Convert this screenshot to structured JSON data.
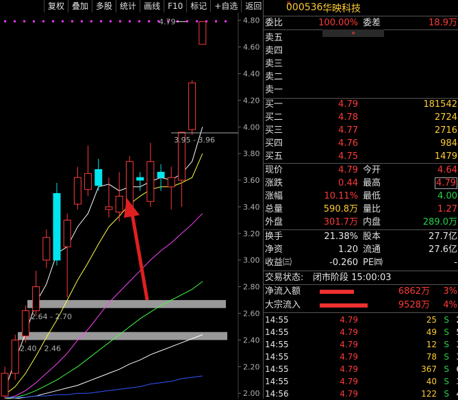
{
  "toolbar": {
    "buttons": [
      "复权",
      "叠加",
      "多股",
      "统计",
      "画线",
      "F10",
      "标记",
      "+自选",
      "返回"
    ]
  },
  "colors": {
    "up": "#ff3b3b",
    "down": "#00e5ee",
    "ma5": "#ffffff",
    "ma10": "#ffff44",
    "ma20": "#ff44ff",
    "ma30": "#44ff44",
    "ma60": "#ffffff",
    "ma120": "#3355ff"
  },
  "chart_data": {
    "type": "candlestick",
    "y_ticks": [
      "4.80",
      "4.60",
      "4.40",
      "4.20",
      "4.00",
      "3.80",
      "3.60",
      "3.40",
      "3.20",
      "3.00",
      "2.80",
      "2.60",
      "2.40",
      "2.20",
      "2.00"
    ],
    "ylim": [
      1.96,
      4.86
    ],
    "annotations": {
      "high_label": "4.79",
      "box_label": "3.95 - 3.96",
      "gap_upper_label": "2.64 - 2.70",
      "gap_lower_label": "2.40 - 2.46"
    },
    "candles": [
      {
        "o": 1.98,
        "c": 2.15,
        "h": 2.2,
        "l": 1.96
      },
      {
        "o": 2.15,
        "c": 2.4,
        "h": 2.44,
        "l": 2.1
      },
      {
        "o": 2.43,
        "c": 2.62,
        "h": 2.66,
        "l": 2.38
      },
      {
        "o": 2.62,
        "c": 2.8,
        "h": 2.92,
        "l": 2.58
      },
      {
        "o": 3.0,
        "c": 3.17,
        "h": 3.23,
        "l": 2.94
      },
      {
        "o": 3.5,
        "c": 3.0,
        "h": 3.58,
        "l": 2.96
      },
      {
        "o": 3.1,
        "c": 3.3,
        "h": 3.35,
        "l": 2.72
      },
      {
        "o": 3.42,
        "c": 3.62,
        "h": 3.7,
        "l": 3.38
      },
      {
        "o": 3.53,
        "c": 3.65,
        "h": 3.86,
        "l": 3.48
      },
      {
        "o": 3.68,
        "c": 3.56,
        "h": 3.76,
        "l": 3.52
      },
      {
        "o": 3.38,
        "c": 3.4,
        "h": 3.62,
        "l": 3.32
      },
      {
        "o": 3.36,
        "c": 3.48,
        "h": 3.66,
        "l": 3.29
      },
      {
        "o": 3.4,
        "c": 3.74,
        "h": 3.78,
        "l": 3.33
      },
      {
        "o": 3.62,
        "c": 3.6,
        "h": 3.66,
        "l": 3.52
      },
      {
        "o": 3.44,
        "c": 3.74,
        "h": 3.88,
        "l": 3.4
      },
      {
        "o": 3.66,
        "c": 3.62,
        "h": 3.72,
        "l": 3.52
      },
      {
        "o": 3.55,
        "c": 3.62,
        "h": 3.7,
        "l": 3.38
      },
      {
        "o": 3.6,
        "c": 3.96,
        "h": 3.96,
        "l": 3.4
      },
      {
        "o": 3.98,
        "c": 4.33,
        "h": 4.35,
        "l": 3.94
      },
      {
        "o": 4.62,
        "c": 4.79,
        "h": 4.79,
        "l": 4.62
      }
    ],
    "series": [
      {
        "values": [
          2.02,
          2.25,
          2.45,
          2.68,
          2.82,
          3.05,
          3.1,
          3.25,
          3.35,
          3.55,
          3.57,
          3.52,
          3.55,
          3.55,
          3.59,
          3.62,
          3.6,
          3.65,
          3.74,
          4.0
        ]
      },
      {
        "values": [
          1.99,
          2.05,
          2.15,
          2.28,
          2.42,
          2.55,
          2.7,
          2.85,
          2.98,
          3.12,
          3.25,
          3.33,
          3.42,
          3.48,
          3.53,
          3.55,
          3.55,
          3.58,
          3.62,
          3.8
        ]
      },
      {
        "values": [
          1.96,
          1.98,
          2.02,
          2.08,
          2.15,
          2.22,
          2.3,
          2.4,
          2.48,
          2.58,
          2.68,
          2.76,
          2.84,
          2.92,
          3.0,
          3.07,
          3.13,
          3.2,
          3.27,
          3.35
        ]
      },
      {
        "values": [
          1.96,
          1.97,
          1.99,
          2.02,
          2.06,
          2.1,
          2.15,
          2.2,
          2.26,
          2.32,
          2.38,
          2.44,
          2.5,
          2.56,
          2.61,
          2.66,
          2.7,
          2.74,
          2.78,
          2.84
        ]
      },
      {
        "values": [
          1.96,
          1.96,
          1.97,
          1.98,
          2.0,
          2.02,
          2.04,
          2.06,
          2.09,
          2.12,
          2.15,
          2.18,
          2.22,
          2.25,
          2.29,
          2.32,
          2.35,
          2.38,
          2.41,
          2.44
        ]
      },
      {
        "values": [
          1.97,
          1.97,
          1.97,
          1.98,
          1.98,
          1.99,
          1.99,
          2.0,
          2.0,
          2.01,
          2.02,
          2.03,
          2.04,
          2.05,
          2.07,
          2.08,
          2.09,
          2.11,
          2.12,
          2.13
        ]
      }
    ]
  },
  "header": {
    "r_badge": "R",
    "code": "000536",
    "name": "华映科技"
  },
  "quote": {
    "weibi_label": "委比",
    "weibi_value": "100.00%",
    "weicha_label": "委差",
    "weicha_value": "18.9万",
    "chevron": "»",
    "sells": [
      {
        "label": "卖五"
      },
      {
        "label": "卖四"
      },
      {
        "label": "卖三"
      },
      {
        "label": "卖二"
      },
      {
        "label": "卖一"
      }
    ],
    "buys": [
      {
        "label": "买一",
        "price": "4.79",
        "vol": "181542"
      },
      {
        "label": "买二",
        "price": "4.78",
        "vol": "2724"
      },
      {
        "label": "买三",
        "price": "4.77",
        "vol": "2716"
      },
      {
        "label": "买四",
        "price": "4.76",
        "vol": "984"
      },
      {
        "label": "买五",
        "price": "4.75",
        "vol": "1479"
      }
    ],
    "stats": [
      {
        "l1": "现价",
        "v1": "4.79",
        "c1": "red",
        "l2": "今开",
        "v2": "4.64",
        "c2": "red"
      },
      {
        "l1": "涨跌",
        "v1": "0.44",
        "c1": "red",
        "l2": "最高",
        "v2": "4.79",
        "c2": "red",
        "boxed": true
      },
      {
        "l1": "涨幅",
        "v1": "10.11%",
        "c1": "red",
        "l2": "最低",
        "v2": "4.00",
        "c2": "green"
      },
      {
        "l1": "总量",
        "v1": "590.8万",
        "c1": "yellow",
        "l2": "量比",
        "v2": "1.27",
        "c2": "red"
      },
      {
        "l1": "外盘",
        "v1": "301.7万",
        "c1": "red",
        "l2": "内盘",
        "v2": "289.0万",
        "c2": "green"
      }
    ],
    "stats2": [
      {
        "l1": "换手",
        "v1": "21.38%",
        "l2": "股本",
        "v2": "27.7亿"
      },
      {
        "l1": "净资",
        "v1": "1.20",
        "l2": "流通",
        "v2": "27.6亿"
      },
      {
        "l1": "收益㈢",
        "v1": "-0.260",
        "l2": "PE㈣",
        "v2": "-"
      }
    ],
    "status_label": "交易状态:",
    "status_value": "闭市阶段 15:00:03",
    "flows": [
      {
        "label": "净流入额",
        "value": "6862万",
        "pct": "3%"
      },
      {
        "label": "大宗流入",
        "value": "9528万",
        "pct": "4%"
      }
    ],
    "ticks": [
      {
        "time": "14:55",
        "price": "4.79",
        "vol": "25",
        "side": "S",
        "n": "2"
      },
      {
        "time": "14:55",
        "price": "4.79",
        "vol": "49",
        "side": "S",
        "n": "5"
      },
      {
        "time": "14:55",
        "price": "4.79",
        "vol": "12",
        "side": "S",
        "n": "3"
      },
      {
        "time": "14:55",
        "price": "4.79",
        "vol": "78",
        "side": "S",
        "n": "3"
      },
      {
        "time": "14:55",
        "price": "4.79",
        "vol": "367",
        "side": "S",
        "n": "6"
      },
      {
        "time": "14:55",
        "price": "4.79",
        "vol": "40",
        "side": "S",
        "n": "3"
      },
      {
        "time": "14:56",
        "price": "4.79",
        "vol": "122",
        "side": "S",
        "n": "4"
      }
    ]
  }
}
